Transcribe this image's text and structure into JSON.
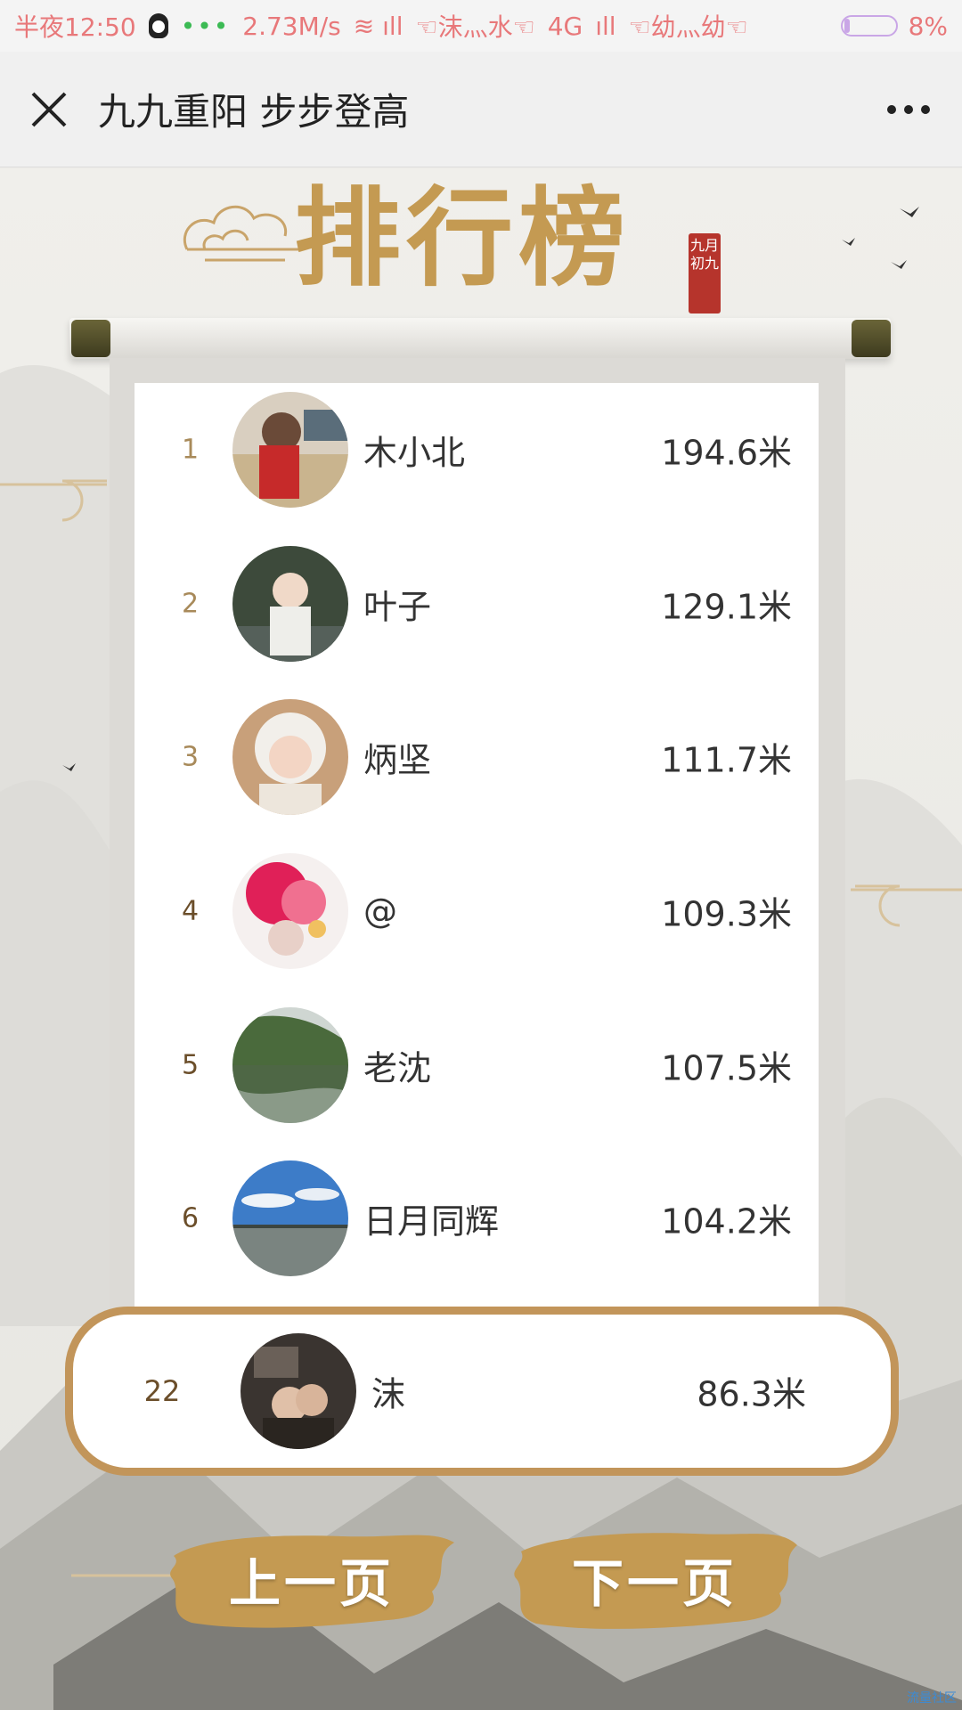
{
  "status_bar": {
    "time": "半夜12:50",
    "speed": "2.73M/s",
    "carrier1": "☜沫灬水☜",
    "network": "4G",
    "carrier2": "☜幼灬幼☜",
    "battery": "8%"
  },
  "nav": {
    "title": "九九重阳 步步登高"
  },
  "header": {
    "headline": "排行榜",
    "seal": "九月初九"
  },
  "ranking": [
    {
      "rank": "1",
      "name": "木小北",
      "distance": "194.6米"
    },
    {
      "rank": "2",
      "name": "叶子",
      "distance": "129.1米"
    },
    {
      "rank": "3",
      "name": "炳坚",
      "distance": "111.7米"
    },
    {
      "rank": "4",
      "name": "@",
      "distance": "109.3米"
    },
    {
      "rank": "5",
      "name": "老沈",
      "distance": "107.5米"
    },
    {
      "rank": "6",
      "name": "日月同辉",
      "distance": "104.2米"
    }
  ],
  "my_rank": {
    "rank": "22",
    "name": "沫",
    "distance": "86.3米"
  },
  "buttons": {
    "prev": "上一页",
    "next": "下一页"
  },
  "watermark": "流量社区",
  "colors": {
    "gold": "#c49a52",
    "seal_red": "#b6342c",
    "status_text": "#e8787a"
  }
}
